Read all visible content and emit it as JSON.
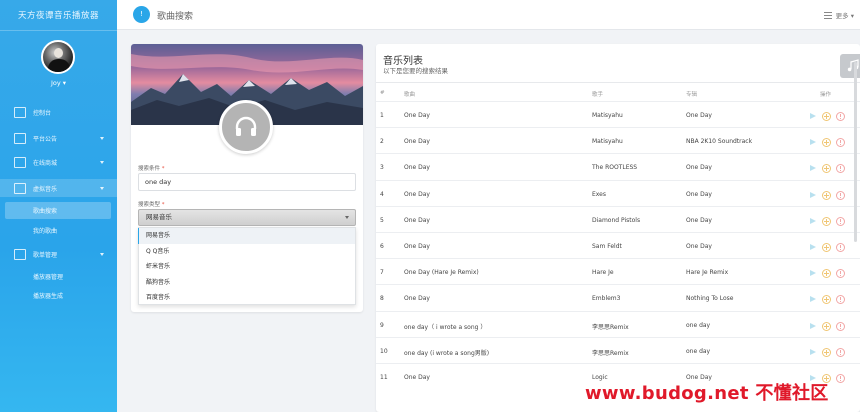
{
  "app": {
    "title": "天方夜谭音乐播放器"
  },
  "user": {
    "name": "Joy ▾"
  },
  "sidebar": {
    "items": [
      {
        "label": "控制台",
        "icon": "home-icon"
      },
      {
        "label": "平台公告",
        "icon": "grid-icon"
      },
      {
        "label": "在线商城",
        "icon": "shop-icon"
      },
      {
        "label": "虚拟音乐",
        "icon": "music-library-icon"
      },
      {
        "label": "歌曲搜索",
        "sub": true
      },
      {
        "label": "我的歌曲",
        "sub": true
      },
      {
        "label": "歌单管理",
        "icon": "playlist-icon"
      },
      {
        "label": "播放器管理",
        "sub": true
      },
      {
        "label": "播放器生成",
        "sub": true
      }
    ]
  },
  "header": {
    "step": "!",
    "title": "歌曲搜索",
    "more_label": "更多 ▾"
  },
  "search": {
    "keyword_label": "搜索条件",
    "keyword_value": "one day",
    "type_label": "搜索类型",
    "type_value": "网易音乐",
    "options": [
      "网易音乐",
      "Q Q音乐",
      "虾米音乐",
      "酷狗音乐",
      "百度音乐"
    ]
  },
  "list": {
    "title": "音乐列表",
    "subtitle": "以下是您要的搜索结果",
    "columns": {
      "num": "#",
      "name": "歌曲",
      "artist": "歌手",
      "album": "专辑",
      "actions": "操作"
    },
    "rows": [
      {
        "num": "1",
        "name": "One Day",
        "artist": "Matisyahu",
        "album": "One Day"
      },
      {
        "num": "2",
        "name": "One Day",
        "artist": "Matisyahu",
        "album": "NBA 2K10 Soundtrack"
      },
      {
        "num": "3",
        "name": "One Day",
        "artist": "The ROOTLESS",
        "album": "One Day"
      },
      {
        "num": "4",
        "name": "One Day",
        "artist": "Exes",
        "album": "One Day"
      },
      {
        "num": "5",
        "name": "One Day",
        "artist": "Diamond Pistols",
        "album": "One Day"
      },
      {
        "num": "6",
        "name": "One Day",
        "artist": "Sam Feldt",
        "album": "One Day"
      },
      {
        "num": "7",
        "name": "One Day (Hare Je Remix)",
        "artist": "Hare Je",
        "album": "Hare Je Remix"
      },
      {
        "num": "8",
        "name": "One Day",
        "artist": "Emblem3",
        "album": "Nothing To Lose"
      },
      {
        "num": "9",
        "name": "one day（ i wrote a song ）",
        "artist": "李思思Remix",
        "album": "one day"
      },
      {
        "num": "10",
        "name": "one day (i wrote a song男版)",
        "artist": "李思思Remix",
        "album": "one day"
      },
      {
        "num": "11",
        "name": "One Day",
        "artist": "Logic",
        "album": "One Day"
      }
    ]
  },
  "watermark": "www.budog.net 不懂社区"
}
